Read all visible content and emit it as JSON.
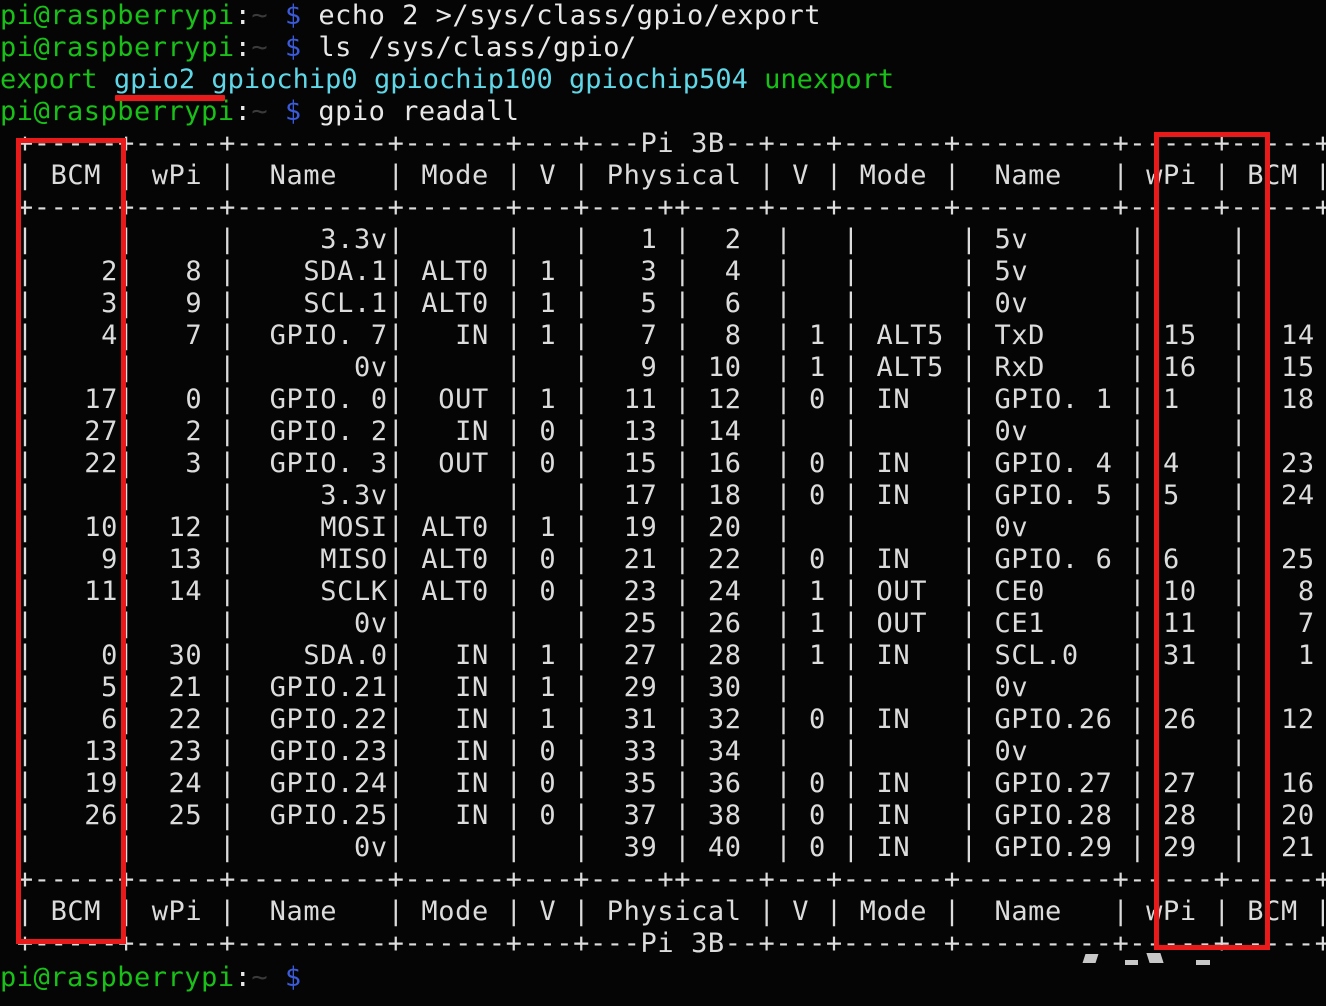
{
  "terminal": {
    "background": "#050505",
    "foreground": "#e8e8e8",
    "prompt_user_host": "pi@raspberrypi",
    "prompt_colon": ":",
    "prompt_path": "~",
    "prompt_sigil": "$",
    "colors": {
      "green": "#18c018",
      "blue": "#3b5bdb",
      "cyan": "#5fd7e7",
      "white": "#e8e8e8",
      "highlight_red": "#e81a1a"
    }
  },
  "session": {
    "command_1": "echo 2 >/sys/class/gpio/export",
    "command_2": "ls /sys/class/gpio/",
    "ls_output": {
      "export": "export",
      "gpio2": "gpio2",
      "gpiochip0": "gpiochip0",
      "gpiochip100": "gpiochip100",
      "gpiochip504": "gpiochip504",
      "unexport": "unexport"
    },
    "command_3": "gpio readall",
    "final_prompt": ""
  },
  "table": {
    "board_label": "Pi 3B",
    "border_top": " +-----+-----+---------+------+---+---Pi 3B--+---+------+---------+-----+-----+",
    "header": " | BCM | wPi |   Name  | Mode | V | Physical | V | Mode | Name    | wPi | BCM |",
    "border_mid": " +-----+-----+---------+------+---+----++----+---+------+---------+-----+-----+",
    "border_bottom": " +-----+-----+---------+------+---+---Pi 3B--+---+------+---------+-----+-----+",
    "columns": [
      "BCM",
      "wPi",
      "Name",
      "Mode",
      "V",
      "Physical",
      "V",
      "Mode",
      "Name",
      "wPi",
      "BCM"
    ],
    "rows": [
      {
        "bcm_l": "",
        "wpi_l": "",
        "name_l": "3.3v",
        "mode_l": "",
        "v_l": "",
        "phys_l": "1",
        "phys_r": "2",
        "v_r": "",
        "mode_r": "",
        "name_r": "5v",
        "wpi_r": "",
        "bcm_r": ""
      },
      {
        "bcm_l": "2",
        "wpi_l": "8",
        "name_l": "SDA.1",
        "mode_l": "ALT0",
        "v_l": "1",
        "phys_l": "3",
        "phys_r": "4",
        "v_r": "",
        "mode_r": "",
        "name_r": "5v",
        "wpi_r": "",
        "bcm_r": ""
      },
      {
        "bcm_l": "3",
        "wpi_l": "9",
        "name_l": "SCL.1",
        "mode_l": "ALT0",
        "v_l": "1",
        "phys_l": "5",
        "phys_r": "6",
        "v_r": "",
        "mode_r": "",
        "name_r": "0v",
        "wpi_r": "",
        "bcm_r": ""
      },
      {
        "bcm_l": "4",
        "wpi_l": "7",
        "name_l": "GPIO. 7",
        "mode_l": "IN",
        "v_l": "1",
        "phys_l": "7",
        "phys_r": "8",
        "v_r": "1",
        "mode_r": "ALT5",
        "name_r": "TxD",
        "wpi_r": "15",
        "bcm_r": "14"
      },
      {
        "bcm_l": "",
        "wpi_l": "",
        "name_l": "0v",
        "mode_l": "",
        "v_l": "",
        "phys_l": "9",
        "phys_r": "10",
        "v_r": "1",
        "mode_r": "ALT5",
        "name_r": "RxD",
        "wpi_r": "16",
        "bcm_r": "15"
      },
      {
        "bcm_l": "17",
        "wpi_l": "0",
        "name_l": "GPIO. 0",
        "mode_l": "OUT",
        "v_l": "1",
        "phys_l": "11",
        "phys_r": "12",
        "v_r": "0",
        "mode_r": "IN",
        "name_r": "GPIO. 1",
        "wpi_r": "1",
        "bcm_r": "18"
      },
      {
        "bcm_l": "27",
        "wpi_l": "2",
        "name_l": "GPIO. 2",
        "mode_l": "IN",
        "v_l": "0",
        "phys_l": "13",
        "phys_r": "14",
        "v_r": "",
        "mode_r": "",
        "name_r": "0v",
        "wpi_r": "",
        "bcm_r": ""
      },
      {
        "bcm_l": "22",
        "wpi_l": "3",
        "name_l": "GPIO. 3",
        "mode_l": "OUT",
        "v_l": "0",
        "phys_l": "15",
        "phys_r": "16",
        "v_r": "0",
        "mode_r": "IN",
        "name_r": "GPIO. 4",
        "wpi_r": "4",
        "bcm_r": "23"
      },
      {
        "bcm_l": "",
        "wpi_l": "",
        "name_l": "3.3v",
        "mode_l": "",
        "v_l": "",
        "phys_l": "17",
        "phys_r": "18",
        "v_r": "0",
        "mode_r": "IN",
        "name_r": "GPIO. 5",
        "wpi_r": "5",
        "bcm_r": "24"
      },
      {
        "bcm_l": "10",
        "wpi_l": "12",
        "name_l": "MOSI",
        "mode_l": "ALT0",
        "v_l": "1",
        "phys_l": "19",
        "phys_r": "20",
        "v_r": "",
        "mode_r": "",
        "name_r": "0v",
        "wpi_r": "",
        "bcm_r": ""
      },
      {
        "bcm_l": "9",
        "wpi_l": "13",
        "name_l": "MISO",
        "mode_l": "ALT0",
        "v_l": "0",
        "phys_l": "21",
        "phys_r": "22",
        "v_r": "0",
        "mode_r": "IN",
        "name_r": "GPIO. 6",
        "wpi_r": "6",
        "bcm_r": "25"
      },
      {
        "bcm_l": "11",
        "wpi_l": "14",
        "name_l": "SCLK",
        "mode_l": "ALT0",
        "v_l": "0",
        "phys_l": "23",
        "phys_r": "24",
        "v_r": "1",
        "mode_r": "OUT",
        "name_r": "CE0",
        "wpi_r": "10",
        "bcm_r": "8"
      },
      {
        "bcm_l": "",
        "wpi_l": "",
        "name_l": "0v",
        "mode_l": "",
        "v_l": "",
        "phys_l": "25",
        "phys_r": "26",
        "v_r": "1",
        "mode_r": "OUT",
        "name_r": "CE1",
        "wpi_r": "11",
        "bcm_r": "7"
      },
      {
        "bcm_l": "0",
        "wpi_l": "30",
        "name_l": "SDA.0",
        "mode_l": "IN",
        "v_l": "1",
        "phys_l": "27",
        "phys_r": "28",
        "v_r": "1",
        "mode_r": "IN",
        "name_r": "SCL.0",
        "wpi_r": "31",
        "bcm_r": "1"
      },
      {
        "bcm_l": "5",
        "wpi_l": "21",
        "name_l": "GPIO.21",
        "mode_l": "IN",
        "v_l": "1",
        "phys_l": "29",
        "phys_r": "30",
        "v_r": "",
        "mode_r": "",
        "name_r": "0v",
        "wpi_r": "",
        "bcm_r": ""
      },
      {
        "bcm_l": "6",
        "wpi_l": "22",
        "name_l": "GPIO.22",
        "mode_l": "IN",
        "v_l": "1",
        "phys_l": "31",
        "phys_r": "32",
        "v_r": "0",
        "mode_r": "IN",
        "name_r": "GPIO.26",
        "wpi_r": "26",
        "bcm_r": "12"
      },
      {
        "bcm_l": "13",
        "wpi_l": "23",
        "name_l": "GPIO.23",
        "mode_l": "IN",
        "v_l": "0",
        "phys_l": "33",
        "phys_r": "34",
        "v_r": "",
        "mode_r": "",
        "name_r": "0v",
        "wpi_r": "",
        "bcm_r": ""
      },
      {
        "bcm_l": "19",
        "wpi_l": "24",
        "name_l": "GPIO.24",
        "mode_l": "IN",
        "v_l": "0",
        "phys_l": "35",
        "phys_r": "36",
        "v_r": "0",
        "mode_r": "IN",
        "name_r": "GPIO.27",
        "wpi_r": "27",
        "bcm_r": "16"
      },
      {
        "bcm_l": "26",
        "wpi_l": "25",
        "name_l": "GPIO.25",
        "mode_l": "IN",
        "v_l": "0",
        "phys_l": "37",
        "phys_r": "38",
        "v_r": "0",
        "mode_r": "IN",
        "name_r": "GPIO.28",
        "wpi_r": "28",
        "bcm_r": "20"
      },
      {
        "bcm_l": "",
        "wpi_l": "",
        "name_l": "0v",
        "mode_l": "",
        "v_l": "",
        "phys_l": "39",
        "phys_r": "40",
        "v_r": "0",
        "mode_r": "IN",
        "name_r": "GPIO.29",
        "wpi_r": "29",
        "bcm_r": "21"
      }
    ]
  },
  "annotations": {
    "highlight_left_column": "BCM",
    "highlight_right_column": "BCM",
    "underline_target": "gpio2"
  }
}
